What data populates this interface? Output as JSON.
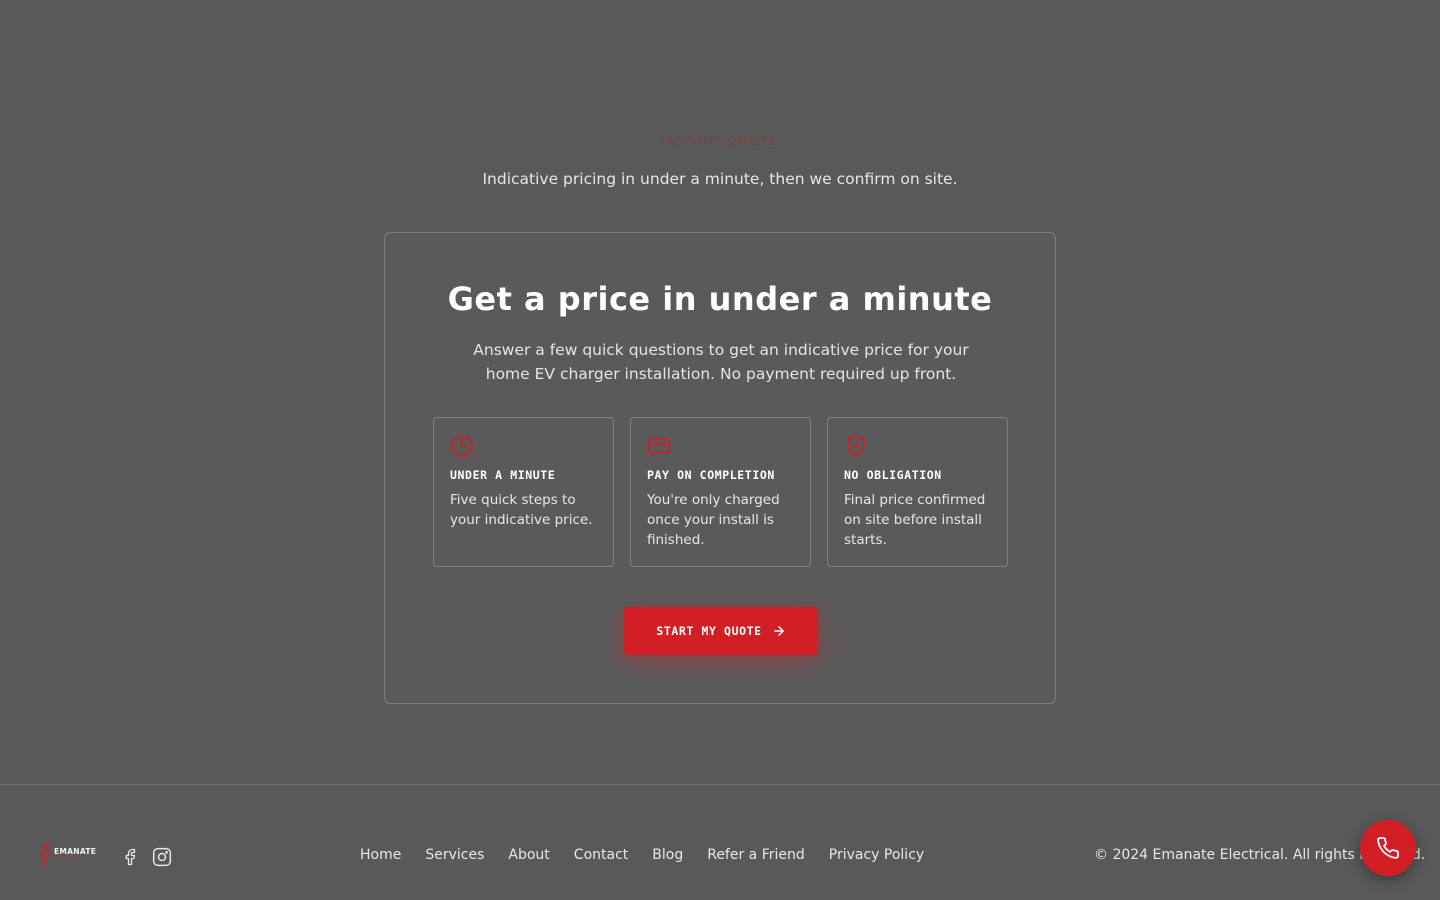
{
  "section": {
    "eyebrow": "INSTANT QUOTE",
    "subtitle": "Indicative pricing in under a minute, then we confirm on site."
  },
  "card": {
    "title": "Get a price in under a minute",
    "description": "Answer a few quick questions to get an indicative price for your home EV charger installation. No payment required up front.",
    "features": [
      {
        "icon": "clock-icon",
        "title": "UNDER A MINUTE",
        "text": "Five quick steps to your indicative price."
      },
      {
        "icon": "wallet-icon",
        "title": "PAY ON COMPLETION",
        "text": "You're only charged once your install is finished."
      },
      {
        "icon": "shield-check-icon",
        "title": "NO OBLIGATION",
        "text": "Final price confirmed on site before install starts."
      }
    ],
    "cta_label": "START MY QUOTE"
  },
  "footer": {
    "logo": {
      "name": "EMANATE",
      "sub": "ELECTRICAL"
    },
    "social": [
      "facebook-icon",
      "instagram-icon"
    ],
    "nav": [
      "Home",
      "Services",
      "About",
      "Contact",
      "Blog",
      "Refer a Friend",
      "Privacy Policy"
    ],
    "copyright": "© 2024 Emanate Electrical. All rights reserved."
  },
  "colors": {
    "background": "#595959",
    "accent": "#d21f26",
    "border": "#808080"
  }
}
